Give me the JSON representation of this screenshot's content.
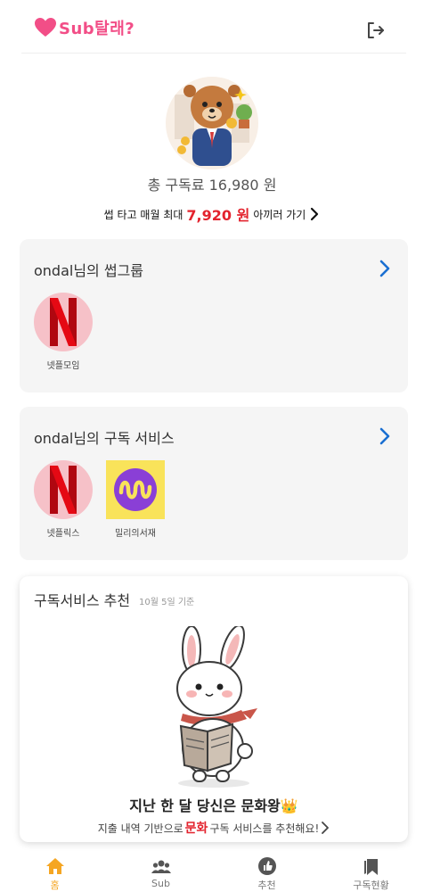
{
  "header": {
    "logo_text": "Sub탈래?"
  },
  "summary": {
    "total_label": "총 구독료 16,980 원",
    "promo_prefix": "썹 타고 매월 최대",
    "promo_amount": "7,920 원",
    "promo_suffix": "아끼러 가기"
  },
  "groups": {
    "title": "ondal님의 썹그룹",
    "items": [
      {
        "label": "넷플모임",
        "icon": "netflix-icon"
      }
    ]
  },
  "subscriptions": {
    "title": "ondal님의 구독 서비스",
    "items": [
      {
        "label": "넷플릭스",
        "icon": "netflix-icon"
      },
      {
        "label": "밀리의서재",
        "icon": "millie-icon"
      }
    ]
  },
  "recommend": {
    "title": "구독서비스 추천",
    "date": "10월 5일 기준",
    "headline": "지난 한 달 당신은 문화왕👑",
    "sub_prefix": "지출 내역 기반으로",
    "sub_highlight": "문화",
    "sub_suffix": "구독 서비스를 추천해요!"
  },
  "tabs": [
    {
      "label": "홈",
      "icon": "home-icon",
      "active": true
    },
    {
      "label": "Sub",
      "icon": "people-icon",
      "active": false
    },
    {
      "label": "추천",
      "icon": "thumbs-up-icon",
      "active": false
    },
    {
      "label": "구독현황",
      "icon": "bookmark-icon",
      "active": false
    }
  ],
  "colors": {
    "brand": "#f24e87",
    "accent_red": "#e3232e",
    "tab_active": "#f5a623",
    "link_blue": "#1a6fd1"
  }
}
